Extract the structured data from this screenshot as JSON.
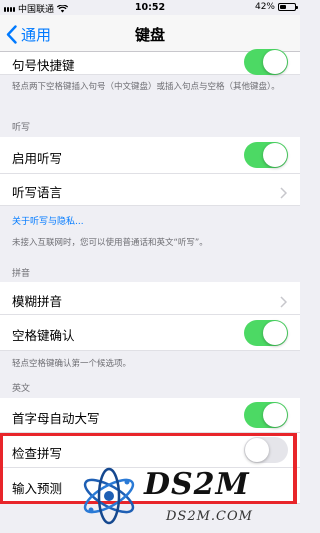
{
  "status_bar": {
    "carrier": "中国联通",
    "time": "10:52",
    "battery": "42%",
    "battery_level": 0.42
  },
  "nav": {
    "back_label": "通用",
    "title": "键盘"
  },
  "rows": {
    "period_shortcut": {
      "label": "句号快捷键",
      "on": true
    },
    "enable_dictation": {
      "label": "启用听写",
      "on": true
    },
    "dictation_languages": {
      "label": "听写语言"
    },
    "fuzzy_pinyin": {
      "label": "模糊拼音"
    },
    "space_confirm": {
      "label": "空格键确认",
      "on": true
    },
    "auto_capitalization": {
      "label": "首字母自动大写",
      "on": true
    },
    "check_spelling": {
      "label": "检查拼写",
      "on": false
    },
    "predictive": {
      "label": "输入预测"
    }
  },
  "texts": {
    "period_footer": "轻点两下空格键插入句号（中文键盘）或插入句点与空格（其他键盘）。",
    "dictation_header": "听写",
    "dictation_link": "关于听写与隐私...",
    "dictation_footer": "未接入互联网时，您可以使用普通话和英文“听写”。",
    "pinyin_header": "拼音",
    "space_footer": "轻点空格键确认第一个候选项。",
    "english_header": "英文"
  },
  "watermark": {
    "title": "DS2M",
    "domain": "DS2M.COM"
  },
  "colors": {
    "accent": "#007aff",
    "toggle_on": "#4cd964",
    "highlight": "#e8252a"
  }
}
